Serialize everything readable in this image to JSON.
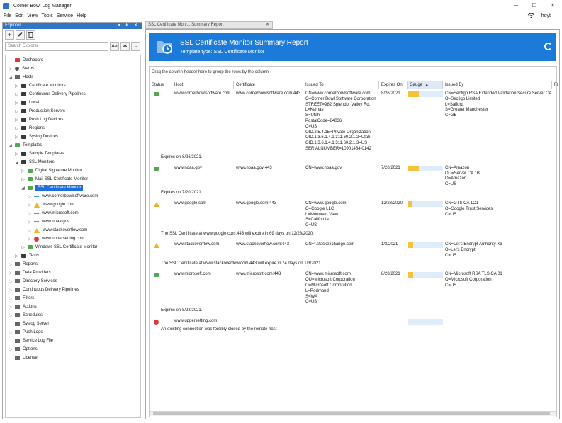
{
  "app": {
    "title": "Corner Bowl Log Manager",
    "user": "hoyt",
    "controls": [
      "─",
      "☐",
      "✕"
    ]
  },
  "menu": [
    "File",
    "Edit",
    "View",
    "Tools",
    "Service",
    "Help"
  ],
  "explorer": {
    "title": "Explorer",
    "header_controls": "▾ ₽ ✕",
    "search_placeholder": "Search Explorer",
    "search_buttons": [
      "Aa",
      "✱",
      "→"
    ],
    "tree": [
      {
        "label": "Dashboard",
        "icon": "dashboard-icon",
        "level": 0,
        "arrow": ""
      },
      {
        "label": "Status",
        "icon": "status-icon",
        "level": 0,
        "arrow": "▷"
      },
      {
        "label": "Hosts",
        "icon": "hosts-icon",
        "level": 0,
        "arrow": "◢"
      },
      {
        "label": "Certificate Monitors",
        "icon": "folder-icon",
        "level": 1,
        "arrow": "▷"
      },
      {
        "label": "Continuous Delivery Pipelines",
        "icon": "folder-icon",
        "level": 1,
        "arrow": "▷"
      },
      {
        "label": "Local",
        "icon": "folder-icon",
        "level": 1,
        "arrow": "▷"
      },
      {
        "label": "Production Servers",
        "icon": "folder-icon",
        "level": 1,
        "arrow": "▷"
      },
      {
        "label": "Push Log Devices",
        "icon": "folder-icon",
        "level": 1,
        "arrow": "▷"
      },
      {
        "label": "Regions",
        "icon": "folder-icon",
        "level": 1,
        "arrow": "▷"
      },
      {
        "label": "Syslog Devices",
        "icon": "folder-icon",
        "level": 1,
        "arrow": "▷"
      },
      {
        "label": "Templates",
        "icon": "templates-icon",
        "level": 0,
        "arrow": "◢"
      },
      {
        "label": "Sample Templates",
        "icon": "folder-icon",
        "level": 1,
        "arrow": "▷"
      },
      {
        "label": "SSL Monitors",
        "icon": "folder-icon",
        "level": 1,
        "arrow": "◢"
      },
      {
        "label": "Digital Signature Monitor",
        "icon": "template-icon",
        "level": 2,
        "arrow": "▷"
      },
      {
        "label": "Mail SSL Certificate Monitor",
        "icon": "template-icon",
        "level": 2,
        "arrow": "▷"
      },
      {
        "label": "SSL Certificate Monitor",
        "icon": "template-icon",
        "level": 2,
        "arrow": "◢",
        "selected": true
      },
      {
        "label": "www.cornerbowlsoftware.com",
        "icon": "ok-dash-icon",
        "level": 3,
        "arrow": "▷"
      },
      {
        "label": "www.google.com",
        "icon": "warning-icon",
        "level": 3,
        "arrow": "▷"
      },
      {
        "label": "www.microsoft.com",
        "icon": "ok-dash-icon",
        "level": 3,
        "arrow": "▷"
      },
      {
        "label": "www.noaa.gov",
        "icon": "ok-dash-icon",
        "level": 3,
        "arrow": "▷"
      },
      {
        "label": "www.stackoverflow.com",
        "icon": "warning-icon",
        "level": 3,
        "arrow": "▷"
      },
      {
        "label": "www.uppersetting.com",
        "icon": "error-icon",
        "level": 3,
        "arrow": "▷"
      },
      {
        "label": "Windows SSL Certificate Monitor",
        "icon": "template-icon",
        "level": 2,
        "arrow": "▷"
      },
      {
        "label": "Tests",
        "icon": "folder-icon",
        "level": 1,
        "arrow": "▷"
      },
      {
        "label": "Reports",
        "icon": "reports-icon",
        "level": 0,
        "arrow": "▷"
      },
      {
        "label": "Data Providers",
        "icon": "data-providers-icon",
        "level": 0,
        "arrow": "▷"
      },
      {
        "label": "Directory Services",
        "icon": "directory-icon",
        "level": 0,
        "arrow": "▷"
      },
      {
        "label": "Continuous Delivery Pipelines",
        "icon": "pipeline-icon",
        "level": 0,
        "arrow": "▷"
      },
      {
        "label": "Filters",
        "icon": "filter-icon",
        "level": 0,
        "arrow": "▷"
      },
      {
        "label": "Actions",
        "icon": "actions-icon",
        "level": 0,
        "arrow": "▷"
      },
      {
        "label": "Schedules",
        "icon": "schedule-icon",
        "level": 0,
        "arrow": "▷"
      },
      {
        "label": "Syslog Server",
        "icon": "syslog-icon",
        "level": 0,
        "arrow": ""
      },
      {
        "label": "Push Logs",
        "icon": "push-logs-icon",
        "level": 0,
        "arrow": "▷"
      },
      {
        "label": "Service Log File",
        "icon": "log-file-icon",
        "level": 0,
        "arrow": ""
      },
      {
        "label": "Options",
        "icon": "options-icon",
        "level": 0,
        "arrow": "▷"
      },
      {
        "label": "License",
        "icon": "license-icon",
        "level": 0,
        "arrow": ""
      }
    ]
  },
  "tab": {
    "label": "SSL Certificate Moni... Summary Report",
    "close": "✕"
  },
  "report": {
    "title": "SSL Certificate Monitor Summary Report",
    "subtitle": "Template type:  SSL Certificate Monitor",
    "group_hint": "Drag the column header here to group the rows by the column",
    "columns": [
      "Status",
      "Host",
      "Certificate",
      "Issued To",
      "Expires On",
      "Gauge",
      "Issued By",
      "Fr"
    ],
    "sort_marker": "▲",
    "rows": [
      {
        "status": "ok",
        "host": "www.cornerbowlsoftware.com",
        "certificate": "www.cornerbowlsoftware.com:443",
        "issued_to": "CN=www.cornerbowlsoftware.com\nO=Corner Bowl Software Corporation\nSTREET=982 Splendor Valley Rd.\nL=Kamas\nS=Utah\nPostalCode=84036\nC=US\nOID.2.5.4.15=Private Organization\nOID.1.3.6.1.4.1.311.60.2.1.2=Utah\nOID.1.3.6.1.4.1.311.60.2.1.3=US\nSERIALNUMBER=10901464-0142",
        "expires_on": "8/26/2021",
        "gauge": 0.3,
        "issued_by": "CN=Sectigo RSA Extended Validation Secure Server CA\nO=Sectigo Limited\nL=Salford\nS=Greater Manchester\nC=GB",
        "message": "Expires on 8/26/2021."
      },
      {
        "status": "ok",
        "host": "www.noaa.gov",
        "certificate": "www.noaa.gov:443",
        "issued_to": "CN=www.noaa.gov",
        "expires_on": "7/20/2021",
        "gauge": 0.3,
        "issued_by": "CN=Amazon\nOU=Server CA 1B\nO=Amazon\nC=US",
        "message": "Expires on 7/20/2021."
      },
      {
        "status": "warning",
        "host": "www.google.com",
        "certificate": "www.google.com:443",
        "issued_to": "CN=www.google.com\nO=Google LLC\nL=Mountain View\nS=California\nC=US",
        "expires_on": "12/28/2020",
        "gauge": 0.12,
        "issued_by": "CN=GTS CA 1O1\nO=Google Trust Services\nC=US",
        "message": "The SSL Certificate at www.google.com:443 will expire in 69 days on 12/28/2020."
      },
      {
        "status": "warning",
        "host": "www.stackoverflow.com",
        "certificate": "www.stackoverflow.com:443",
        "issued_to": "CN=*.stackexchange.com",
        "expires_on": "1/3/2021",
        "gauge": 0.15,
        "issued_by": "CN=Let's Encrypt Authority X3\nO=Let's Encrypt\nC=US",
        "message": "The SSL Certificate at www.stackoverflow.com:443 will expire in 74 days on 1/3/2021."
      },
      {
        "status": "ok",
        "host": "www.microsoft.com",
        "certificate": "www.microsoft.com:443",
        "issued_to": "CN=www.microsoft.com\nOU=Microsoft Corporation\nO=Microsoft Corporation\nL=Redmond\nS=WA\nC=US",
        "expires_on": "8/28/2021",
        "gauge": 0.15,
        "issued_by": "CN=Microsoft RSA TLS CA 01\nO=Microsoft Corporation\nC=US",
        "message": "Expires on 8/28/2021."
      },
      {
        "status": "error",
        "host": "www.uppersetting.com",
        "certificate": "",
        "issued_to": "",
        "expires_on": "",
        "gauge": 0,
        "issued_by": "",
        "message": "An existing connection was forcibly closed by the remote host"
      }
    ]
  },
  "colors": {
    "accent": "#1c7ad9",
    "gauge": "#f5c23a",
    "gauge_bg": "#deedf9",
    "ok": "#52a852",
    "warning": "#f2b21b",
    "error": "#d93a3a"
  }
}
